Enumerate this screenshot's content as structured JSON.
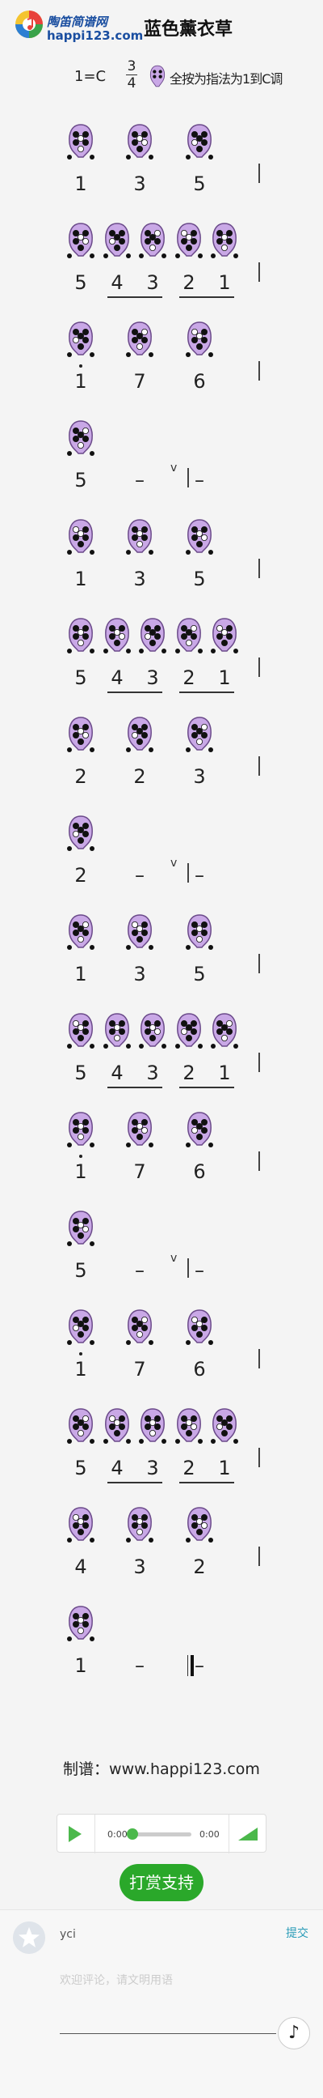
{
  "header": {
    "logo_line1": "陶笛简谱网",
    "logo_line2": "happi123.com",
    "title": "蓝色薰衣草"
  },
  "key": {
    "label": "1=C",
    "time_top": "3",
    "time_bottom": "4",
    "fingering_a": "指法为1到C调",
    "fingering_b": "全按为"
  },
  "score": {
    "rows": [
      {
        "notes": [
          "1",
          "3",
          "5"
        ],
        "dots": [
          false,
          false,
          false
        ],
        "bar": "single"
      },
      {
        "notes": [
          "5",
          "4",
          "3",
          "2",
          "1"
        ],
        "dots": [
          false,
          false,
          false,
          false,
          false
        ],
        "bar": "single",
        "underline": [
          [
            1,
            2
          ],
          [
            3,
            4
          ]
        ]
      },
      {
        "notes": [
          "1",
          "7",
          "6"
        ],
        "dots": [
          true,
          false,
          false
        ],
        "bar": "single"
      },
      {
        "notes": [
          "5",
          "–",
          "–"
        ],
        "dots": [
          false,
          false,
          false
        ],
        "bar": "breath",
        "single_icon": true
      },
      {
        "notes": [
          "1",
          "3",
          "5"
        ],
        "dots": [
          false,
          false,
          false
        ],
        "bar": "single"
      },
      {
        "notes": [
          "5",
          "4",
          "3",
          "2",
          "1"
        ],
        "dots": [
          false,
          false,
          false,
          false,
          false
        ],
        "bar": "single",
        "underline": [
          [
            1,
            2
          ],
          [
            3,
            4
          ]
        ]
      },
      {
        "notes": [
          "2",
          "2",
          "3"
        ],
        "dots": [
          false,
          false,
          false
        ],
        "bar": "single"
      },
      {
        "notes": [
          "2",
          "–",
          "–"
        ],
        "dots": [
          false,
          false,
          false
        ],
        "bar": "breath",
        "single_icon": true
      },
      {
        "notes": [
          "1",
          "3",
          "5"
        ],
        "dots": [
          false,
          false,
          false
        ],
        "bar": "single"
      },
      {
        "notes": [
          "5",
          "4",
          "3",
          "2",
          "1"
        ],
        "dots": [
          false,
          false,
          false,
          false,
          false
        ],
        "bar": "single",
        "underline": [
          [
            1,
            2
          ],
          [
            3,
            4
          ]
        ]
      },
      {
        "notes": [
          "1",
          "7",
          "6"
        ],
        "dots": [
          true,
          false,
          false
        ],
        "bar": "single"
      },
      {
        "notes": [
          "5",
          "–",
          "–"
        ],
        "dots": [
          false,
          false,
          false
        ],
        "bar": "breath",
        "single_icon": true
      },
      {
        "notes": [
          "1",
          "7",
          "6"
        ],
        "dots": [
          true,
          false,
          false
        ],
        "bar": "single"
      },
      {
        "notes": [
          "5",
          "4",
          "3",
          "2",
          "1"
        ],
        "dots": [
          false,
          false,
          false,
          false,
          false
        ],
        "bar": "single",
        "underline": [
          [
            1,
            2
          ],
          [
            3,
            4
          ]
        ]
      },
      {
        "notes": [
          "4",
          "3",
          "2"
        ],
        "dots": [
          false,
          false,
          false
        ],
        "bar": "single"
      },
      {
        "notes": [
          "1",
          "–",
          "–"
        ],
        "dots": [
          false,
          false,
          false
        ],
        "bar": "end",
        "single_icon": true
      }
    ],
    "breath_mark": "v"
  },
  "credit": "制谱：www.happi123.com",
  "player": {
    "current_time": "0:00",
    "duration": "0:00",
    "progress": 0
  },
  "reward_label": "打赏支持",
  "comment": {
    "username": "yci",
    "submit_label": "提交",
    "placeholder": "欢迎评论，请文明用语"
  },
  "colors": {
    "ocarina_fill": "#c9a8e6",
    "ocarina_stroke": "#6b4a8a",
    "accent_green": "#2aa82a"
  }
}
